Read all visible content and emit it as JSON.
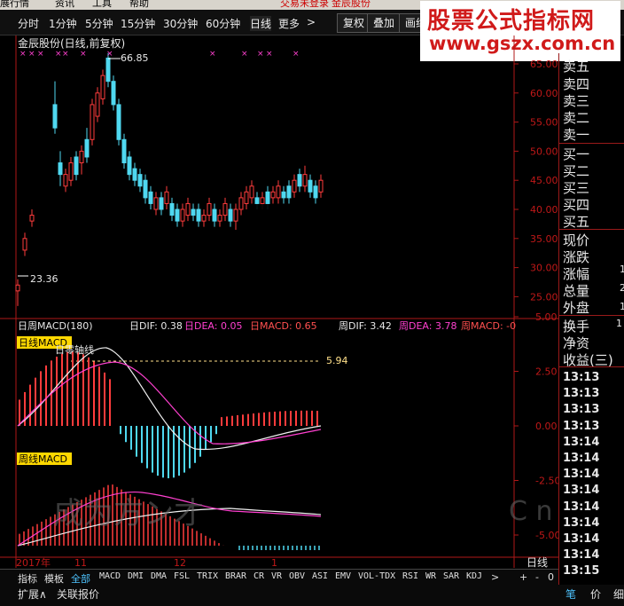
{
  "menu": {
    "items": [
      "展行情",
      "资讯",
      "工具",
      "帮助"
    ],
    "status": "交易未登录",
    "stock": "金辰股份"
  },
  "periods": {
    "tabs": [
      "分时",
      "1分钟",
      "5分钟",
      "15分钟",
      "30分钟",
      "60分钟",
      "日线",
      "更多"
    ],
    "active": "日线",
    "more_arrow": ">"
  },
  "toolbar": {
    "buttons": [
      "复权",
      "叠加",
      "画线"
    ]
  },
  "watermark": {
    "title": "股票公式指标网",
    "url": "www.gszx.com.cn"
  },
  "chart": {
    "title": "金辰股份(日线,前复权)",
    "high_label": "66.85",
    "low_label": "23.36",
    "macd_dashed_label": "5.94",
    "right_period_label": "日线",
    "macd_header": {
      "name": "日周MACD(180)",
      "dif_label": "日DIF: 0.38",
      "dea_label": "日DEA: 0.05",
      "macd_label": "日MACD: 0.65",
      "wdif_label": "周DIF: 3.42",
      "wdea_label": "周DEA: 3.78",
      "wmacd_label": "周MACD: -0"
    },
    "daily_macd_tag": "日线MACD",
    "zero_axis_tag": "日零轴线",
    "weekly_macd_tag": "周线MACD",
    "overlay_text": "成为方ン才",
    "overlay_text_right": "C n",
    "x_labels": [
      "2017年",
      "11",
      "12",
      "1"
    ],
    "colors": {
      "up": "#ff3c3c",
      "down": "#4fd8f0",
      "dif": "#f0f0f0",
      "dea": "#ff40d0",
      "axis": "#b01818",
      "grid": "#3a0c0c"
    }
  },
  "chart_data": {
    "type": "candlestick",
    "price_axis": {
      "ticks": [
        65.0,
        60.0,
        55.0,
        50.0,
        45.0,
        40.0,
        35.0,
        30.0,
        25.0
      ]
    },
    "macd_axis": {
      "ticks": [
        5.0,
        2.5,
        0.0,
        -2.5,
        -5.0
      ]
    },
    "high": 66.85,
    "low": 23.36,
    "daily_macd_level": 5.94
  },
  "side": {
    "order_rows": [
      "卖五",
      "卖四",
      "卖三",
      "卖二",
      "卖一",
      "买一",
      "买二",
      "买三",
      "买四",
      "买五"
    ],
    "quote_rows": [
      "现价",
      "涨跌",
      "涨幅",
      "总量",
      "外盘"
    ],
    "quote_rows2": [
      "换手",
      "净资",
      "收益(三)"
    ],
    "values": [
      "1",
      "2",
      "1",
      "1"
    ],
    "ticks": [
      "13:13",
      "13:13",
      "13:13",
      "13:13",
      "13:14",
      "13:14",
      "13:14",
      "13:14",
      "13:14",
      "13:14",
      "13:14",
      "13:14",
      "13:15"
    ],
    "footer": [
      "笔",
      "价",
      "细"
    ]
  },
  "bottom": {
    "tabs": [
      "指标",
      "模板",
      "全部",
      "MACD",
      "DMI",
      "DMA",
      "FSL",
      "TRIX",
      "BRAR",
      "CR",
      "VR",
      "OBV",
      "ASI",
      "EMV",
      "VOL-TDX",
      "RSI",
      "WR",
      "SAR",
      "KDJ"
    ],
    "active": "全部",
    "arrow": ">",
    "plus": "+",
    "minus": "-",
    "zero": "0",
    "row2": [
      "扩展∧",
      "关联报价"
    ]
  }
}
